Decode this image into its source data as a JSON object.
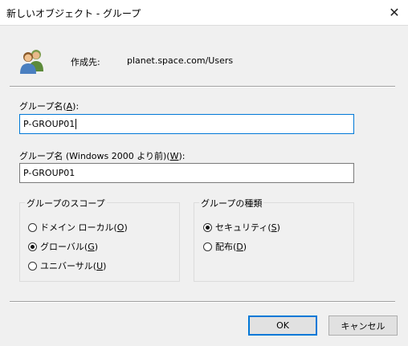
{
  "window": {
    "title": "新しいオブジェクト - グループ",
    "close_glyph": "✕"
  },
  "header": {
    "create_in_label": "作成先:",
    "create_in_path": "planet.space.com/Users",
    "icon": "users-group-icon"
  },
  "group_name": {
    "label_text": "グループ名(",
    "label_accel": "A",
    "label_tail": "):",
    "value": "P-GROUP01"
  },
  "group_name_pre2000": {
    "label_text": "グループ名 (Windows 2000 より前)(",
    "label_accel": "W",
    "label_tail": "):",
    "value": "P-GROUP01"
  },
  "scope": {
    "title": "グループのスコープ",
    "options": [
      {
        "text": "ドメイン ローカル(",
        "accel": "O",
        "tail": ")",
        "selected": false
      },
      {
        "text": "グローバル(",
        "accel": "G",
        "tail": ")",
        "selected": true
      },
      {
        "text": "ユニバーサル(",
        "accel": "U",
        "tail": ")",
        "selected": false
      }
    ]
  },
  "type": {
    "title": "グループの種類",
    "options": [
      {
        "text": "セキュリティ(",
        "accel": "S",
        "tail": ")",
        "selected": true
      },
      {
        "text": "配布(",
        "accel": "D",
        "tail": ")",
        "selected": false
      }
    ]
  },
  "buttons": {
    "ok": "OK",
    "cancel": "キャンセル"
  },
  "colors": {
    "focus_border": "#0078d7",
    "dialog_background": "#f0f0f0"
  }
}
